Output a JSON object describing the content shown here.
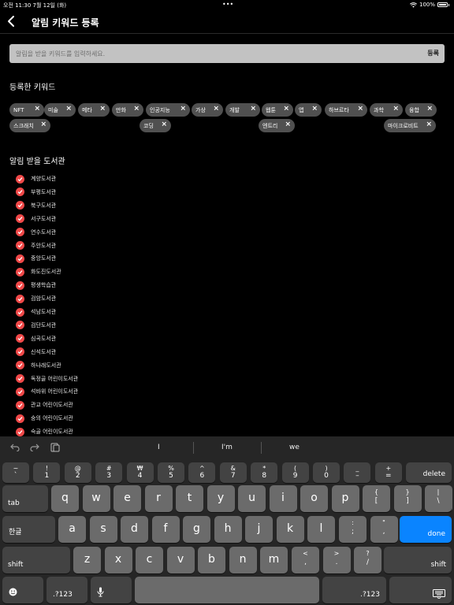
{
  "status": {
    "time": "오전 11:30",
    "date": "7월 12일 (화)",
    "battery": "100%"
  },
  "header": {
    "title": "알림 키워드 등록"
  },
  "search": {
    "placeholder": "알림을 받을 키워드를 입력하세요.",
    "register_label": "등록"
  },
  "keywords_title": "등록한 키워드",
  "keywords": [
    "NFT",
    "미술",
    "메타",
    "만화",
    "인공지능",
    "가상",
    "개발",
    "웹툰",
    "앱",
    "하브르타",
    "과학",
    "융합",
    "스크래치",
    "코딩",
    "엔트리",
    "마이크로비트"
  ],
  "libraries_title": "알림 받을 도서관",
  "libraries": [
    "계양도서관",
    "부평도서관",
    "북구도서관",
    "서구도서관",
    "연수도서관",
    "주안도서관",
    "중앙도서관",
    "화도진도서관",
    "평생학습관",
    "검암도서관",
    "석남도서관",
    "검단도서관",
    "심곡도서관",
    "신석도서관",
    "하나래도서관",
    "독정골 어린이도서관",
    "석바위 어린이도서관",
    "관교 어린이도서관",
    "숭의 어린이도서관",
    "숙골 어린이도서관"
  ],
  "keyboard": {
    "suggestions": [
      "I",
      "I'm",
      "we"
    ],
    "row1": [
      {
        "top": "~",
        "bottom": "`"
      },
      {
        "top": "!",
        "bottom": "1"
      },
      {
        "top": "@",
        "bottom": "2"
      },
      {
        "top": "#",
        "bottom": "3"
      },
      {
        "top": "₩",
        "bottom": "4"
      },
      {
        "top": "%",
        "bottom": "5"
      },
      {
        "top": "^",
        "bottom": "6"
      },
      {
        "top": "&",
        "bottom": "7"
      },
      {
        "top": "*",
        "bottom": "8"
      },
      {
        "top": "(",
        "bottom": "9"
      },
      {
        "top": ")",
        "bottom": "0"
      },
      {
        "top": "_",
        "bottom": "–"
      },
      {
        "top": "+",
        "bottom": "="
      }
    ],
    "delete_label": "delete",
    "tab_label": "tab",
    "row2": [
      "q",
      "w",
      "e",
      "r",
      "t",
      "y",
      "u",
      "i",
      "o",
      "p"
    ],
    "row2_symbols": [
      {
        "top": "{",
        "bottom": "["
      },
      {
        "top": "}",
        "bottom": "]"
      },
      {
        "top": "|",
        "bottom": "\\"
      }
    ],
    "lang_label": "한글",
    "row3": [
      "a",
      "s",
      "d",
      "f",
      "g",
      "h",
      "j",
      "k",
      "l"
    ],
    "row3_symbols": [
      {
        "top": ":",
        "bottom": ";"
      },
      {
        "top": "\"",
        "bottom": ","
      }
    ],
    "done_label": "done",
    "shift_label": "shift",
    "row4": [
      "z",
      "x",
      "c",
      "v",
      "b",
      "n",
      "m"
    ],
    "row4_symbols": [
      {
        "top": "<",
        "bottom": ","
      },
      {
        "top": ">",
        "bottom": "."
      },
      {
        "top": "?",
        "bottom": "/"
      }
    ],
    "numbers_label": ".?123"
  }
}
